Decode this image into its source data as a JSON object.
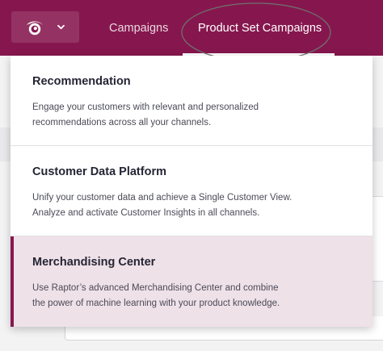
{
  "colors": {
    "brand": "#86174e",
    "highlight_row": "#efe1e8",
    "annotation": "#6f6f6f"
  },
  "header": {
    "logo_icon": "raptor-eye-logo-icon",
    "menu_icon": "chevron-down-icon",
    "tabs": [
      {
        "label": "Campaigns",
        "active": false
      },
      {
        "label": "Product Set Campaigns",
        "active": true
      }
    ]
  },
  "dropdown": {
    "items": [
      {
        "title": "Recommendation",
        "desc_line1": "Engage your customers with relevant and personalized",
        "desc_line2": "recommendations across all your channels.",
        "selected": false
      },
      {
        "title": "Customer Data Platform",
        "desc_line1": "Unify your customer data and achieve a Single Customer View.",
        "desc_line2": "Analyze and activate Customer Insights in all channels.",
        "selected": false
      },
      {
        "title": "Merchandising Center",
        "desc_line1": "Use Raptor’s advanced Merchandising Center and combine",
        "desc_line2": "the power of machine learning with your product knowledge.",
        "selected": true
      }
    ]
  }
}
